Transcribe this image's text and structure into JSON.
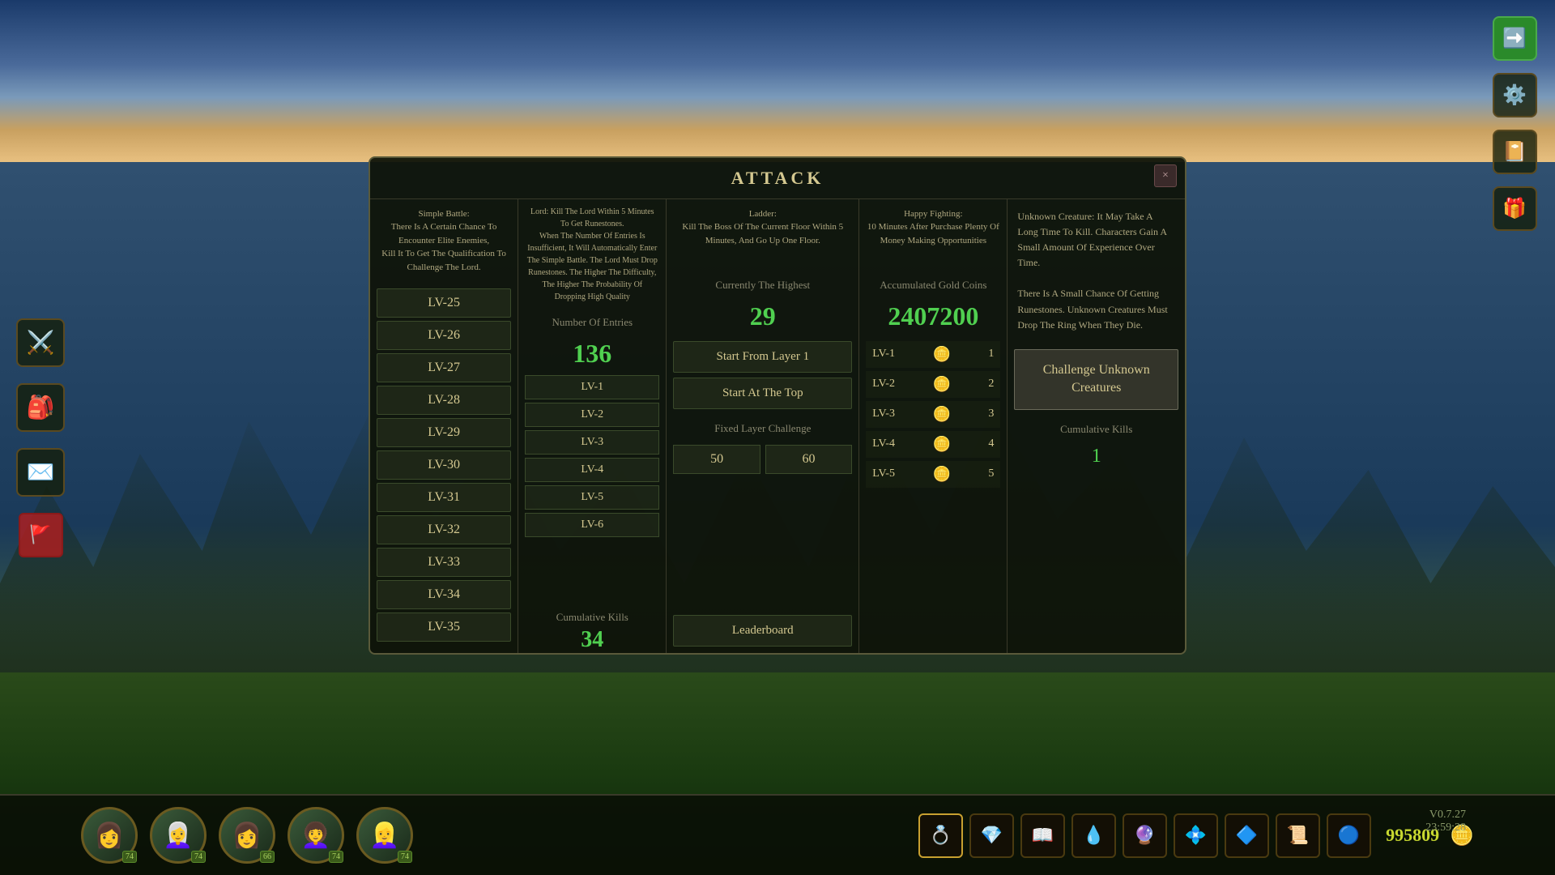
{
  "background": {
    "gradient": "linear-gradient(180deg, #1a3a6a 0%, #4a6a9a 40%, #2a4a6a 60%, #4a6a3a 80%, #1a3010 100%)"
  },
  "modal": {
    "title": "ATTACK",
    "close_label": "×"
  },
  "simple_battle": {
    "header": "Simple Battle:\nThere Is A Certain Chance To Encounter Elite Enemies,\nKill It To Get The Qualification To Challenge The Lord."
  },
  "lord_info": {
    "text": "Lord: Kill The Lord Within 5 Minutes To Get Runestones.\nWhen The Number Of Entries Is Insufficient, It Will Automatically Enter The Simple Battle. The Lord Must Drop Runestones. The Higher The Difficulty, The Higher The Probability Of Dropping High Quality"
  },
  "ladder": {
    "header": "Ladder:\nKill The Boss Of The Current Floor Within 5 Minutes, And Go Up One Floor.",
    "stat_label": "Currently The Highest",
    "stat_value": "29",
    "buttons": {
      "start_from_layer": "Start From Layer 1",
      "start_at_top": "Start At The Top"
    },
    "fixed_challenge_label": "Fixed Layer Challenge",
    "fixed_value_1": "50",
    "fixed_value_2": "60",
    "entries": [
      "LV-1",
      "LV-2",
      "LV-3",
      "LV-4",
      "LV-5",
      "LV-6"
    ],
    "leaderboard_btn": "Leaderboard",
    "kills_label": "Cumulative Kills",
    "kills_value": "34"
  },
  "happy_fighting": {
    "header": "Happy Fighting:\n10 Minutes After Purchase Plenty Of Money Making Opportunities",
    "stat_label": "Accumulated Gold Coins",
    "stat_value": "2407200",
    "rows": [
      {
        "level": "LV-1",
        "coins": 1
      },
      {
        "level": "LV-2",
        "coins": 2
      },
      {
        "level": "LV-3",
        "coins": 3
      },
      {
        "level": "LV-4",
        "coins": 4
      },
      {
        "level": "LV-5",
        "coins": 5
      }
    ]
  },
  "unknown_creatures": {
    "header": "Unknown Creature: It May Take A Long Time To Kill. Characters Gain A Small Amount Of Experience Over Time.\nThere Is A Small Chance Of Getting Runestones. Unknown Creatures Must Drop The Ring When They Die.",
    "challenge_btn": "Challenge Unknown\nCreatures",
    "cumulative_label": "Cumulative Kills",
    "cumulative_value": "1"
  },
  "simple_battle_levels": [
    "LV-25",
    "LV-26",
    "LV-27",
    "LV-28",
    "LV-29",
    "LV-30",
    "LV-31",
    "LV-32",
    "LV-33",
    "LV-34",
    "LV-35"
  ],
  "lord_entries": {
    "stat_label": "Number Of Entries",
    "stat_value": "136",
    "entries": [
      "LV-1",
      "LV-2",
      "LV-3",
      "LV-4",
      "LV-5",
      "LV-6"
    ],
    "kills_label": "Cumulative Kills",
    "kills_value": "34"
  },
  "bottom_bar": {
    "characters": [
      {
        "emoji": "👩",
        "level": 74
      },
      {
        "emoji": "👩‍🦳",
        "level": 74
      },
      {
        "emoji": "👩",
        "level": 66
      },
      {
        "emoji": "👩‍🦱",
        "level": 74
      },
      {
        "emoji": "👱‍♀️",
        "level": 74
      }
    ],
    "gold": "995809",
    "items": [
      "💍",
      "💎",
      "📖",
      "💧",
      "🔮",
      "💠",
      "🔷",
      "📜",
      "🔵"
    ],
    "version": "V0.7.27",
    "time": "23:59:28"
  },
  "right_sidebar": {
    "arrow_icon": "→",
    "gear_icon": "⚙",
    "book_icon": "📔",
    "gift_icon": "🎁"
  },
  "left_sidebar": {
    "sword_icon": "⚔",
    "bag_icon": "🎒",
    "mail_icon": "✉",
    "flag_icon": "🚩"
  }
}
